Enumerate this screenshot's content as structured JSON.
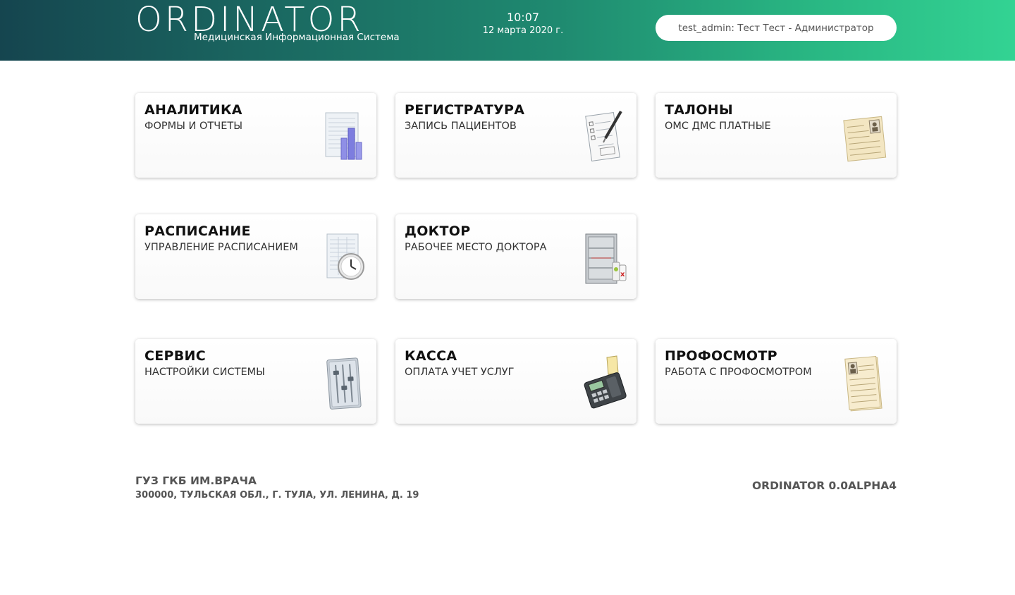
{
  "header": {
    "app_title": "ORDINATOR",
    "app_subtitle": "Медицинская Информационная Система",
    "time": "10:07",
    "date": "12 марта 2020 г.",
    "user": "test_admin: Тест Тест - Администратор",
    "gradient_colors": [
      "#15454f",
      "#33d393"
    ]
  },
  "cards": [
    {
      "title": "АНАЛИТИКА",
      "subtitle": "ФОРМЫ И ОТЧЕТЫ",
      "icon": "bar-chart-report-icon"
    },
    {
      "title": "РЕГИСТРАТУРА",
      "subtitle": "ЗАПИСЬ ПАЦИЕНТОВ",
      "icon": "form-pen-icon"
    },
    {
      "title": "ТАЛОНЫ",
      "subtitle": "ОМС ДМС ПЛАТНЫЕ",
      "icon": "id-card-icon"
    },
    {
      "title": "РАСПИСАНИЕ",
      "subtitle": "УПРАВЛЕНИЕ РАСПИСАНИЕМ",
      "icon": "schedule-clock-icon"
    },
    {
      "title": "ДОКТОР",
      "subtitle": "РАБОЧЕЕ МЕСТО ДОКТОРА",
      "icon": "medicine-cabinet-icon"
    },
    {
      "title": "СЕРВИС",
      "subtitle": "НАСТРОЙКИ СИСТЕМЫ",
      "icon": "settings-sliders-icon"
    },
    {
      "title": "КАССА",
      "subtitle": "ОПЛАТА УЧЕТ УСЛУГ",
      "icon": "cash-register-icon"
    },
    {
      "title": "ПРОФОСМОТР",
      "subtitle": "РАБОТА С ПРОФОСМОТРОМ",
      "icon": "medical-record-icon"
    }
  ],
  "footer": {
    "org_name": "ГУЗ ГКБ ИМ.ВРАЧА",
    "org_address": "300000, ТУЛЬСКАЯ ОБЛ., Г. ТУЛА, УЛ. ЛЕНИНА, Д. 19",
    "version": "ORDINATOR 0.0ALPHA4"
  }
}
